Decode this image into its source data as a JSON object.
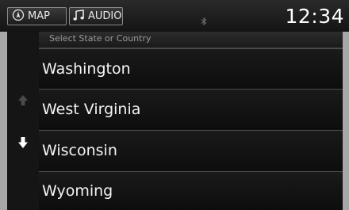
{
  "topbar": {
    "map_label": "MAP",
    "audio_label": "AUDIO",
    "clock": "12:34",
    "icons": {
      "map": "compass-icon",
      "audio": "music-note-icon",
      "status": "bluetooth-icon"
    }
  },
  "list": {
    "header": "Select State or Country",
    "items": [
      {
        "label": "Washington"
      },
      {
        "label": "West Virginia"
      },
      {
        "label": "Wisconsin"
      },
      {
        "label": "Wyoming"
      }
    ]
  },
  "scroll": {
    "up_icon": "arrow-up-icon",
    "down_icon": "arrow-down-icon",
    "up_enabled": false,
    "down_enabled": true
  }
}
